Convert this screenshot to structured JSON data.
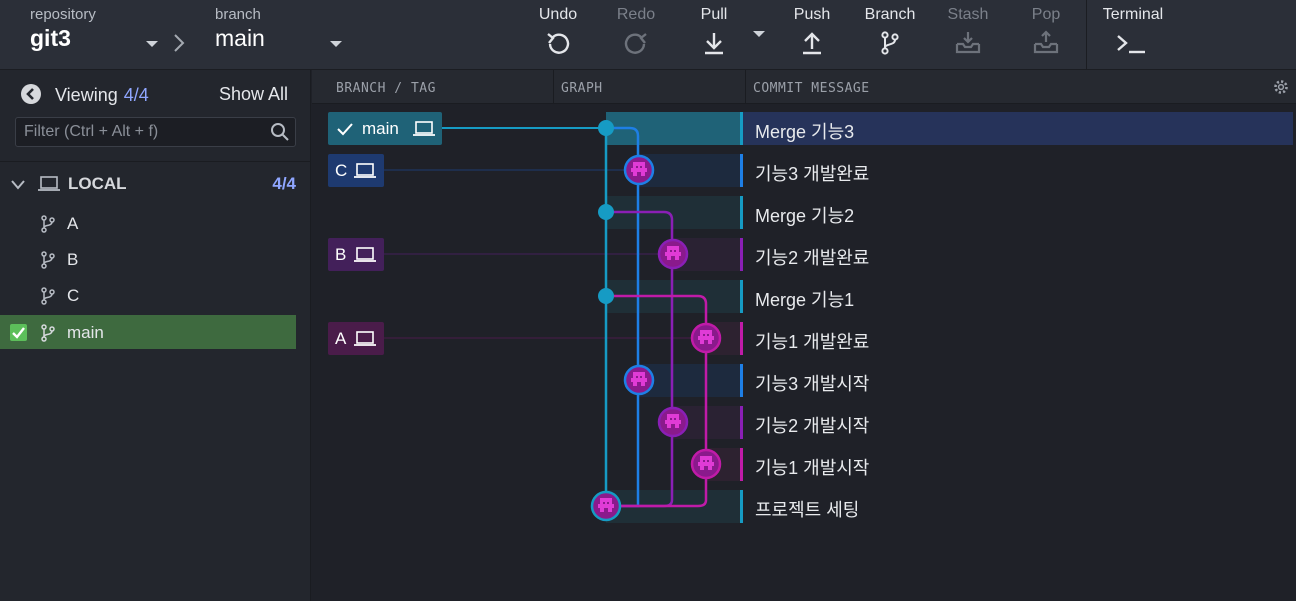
{
  "toolbar": {
    "repository_label": "repository",
    "repository_value": "git3",
    "branch_label": "branch",
    "branch_value": "main",
    "buttons": {
      "undo": "Undo",
      "redo": "Redo",
      "pull": "Pull",
      "push": "Push",
      "branch": "Branch",
      "stash": "Stash",
      "pop": "Pop",
      "terminal": "Terminal"
    }
  },
  "sidebar": {
    "viewing_label": "Viewing",
    "viewing_count": "4/4",
    "show_all": "Show All",
    "filter_placeholder": "Filter (Ctrl + Alt + f)",
    "local_label": "LOCAL",
    "local_count": "4/4",
    "branches": [
      {
        "name": "A"
      },
      {
        "name": "B"
      },
      {
        "name": "C"
      },
      {
        "name": "main",
        "active": true
      }
    ]
  },
  "columns": {
    "branch_tag": "BRANCH / TAG",
    "graph": "GRAPH",
    "commit_message": "COMMIT MESSAGE"
  },
  "tags": {
    "main": "main",
    "c": "C",
    "b": "B",
    "a": "A"
  },
  "commits": [
    {
      "message": "Merge 기능3",
      "lane": "main",
      "kind": "merge",
      "selected": true
    },
    {
      "message": "기능3 개발완료",
      "lane": "c",
      "kind": "commit"
    },
    {
      "message": "Merge 기능2",
      "lane": "main",
      "kind": "merge"
    },
    {
      "message": "기능2 개발완료",
      "lane": "b",
      "kind": "commit"
    },
    {
      "message": "Merge 기능1",
      "lane": "main",
      "kind": "merge"
    },
    {
      "message": "기능1 개발완료",
      "lane": "a",
      "kind": "commit"
    },
    {
      "message": "기능3 개발시작",
      "lane": "c",
      "kind": "commit"
    },
    {
      "message": "기능2 개발시작",
      "lane": "b",
      "kind": "commit"
    },
    {
      "message": "기능1 개발시작",
      "lane": "a",
      "kind": "commit"
    },
    {
      "message": "프로젝트 세팅",
      "lane": "main",
      "kind": "commit"
    }
  ],
  "colors": {
    "main_lane": "#169bc4",
    "c_lane": "#1e7fe6",
    "b_lane": "#8a1fb5",
    "a_lane": "#c01ba8",
    "selected_row": "#26335a",
    "active_branch": "#3e6a3f",
    "count_accent": "#8fa6ff"
  }
}
